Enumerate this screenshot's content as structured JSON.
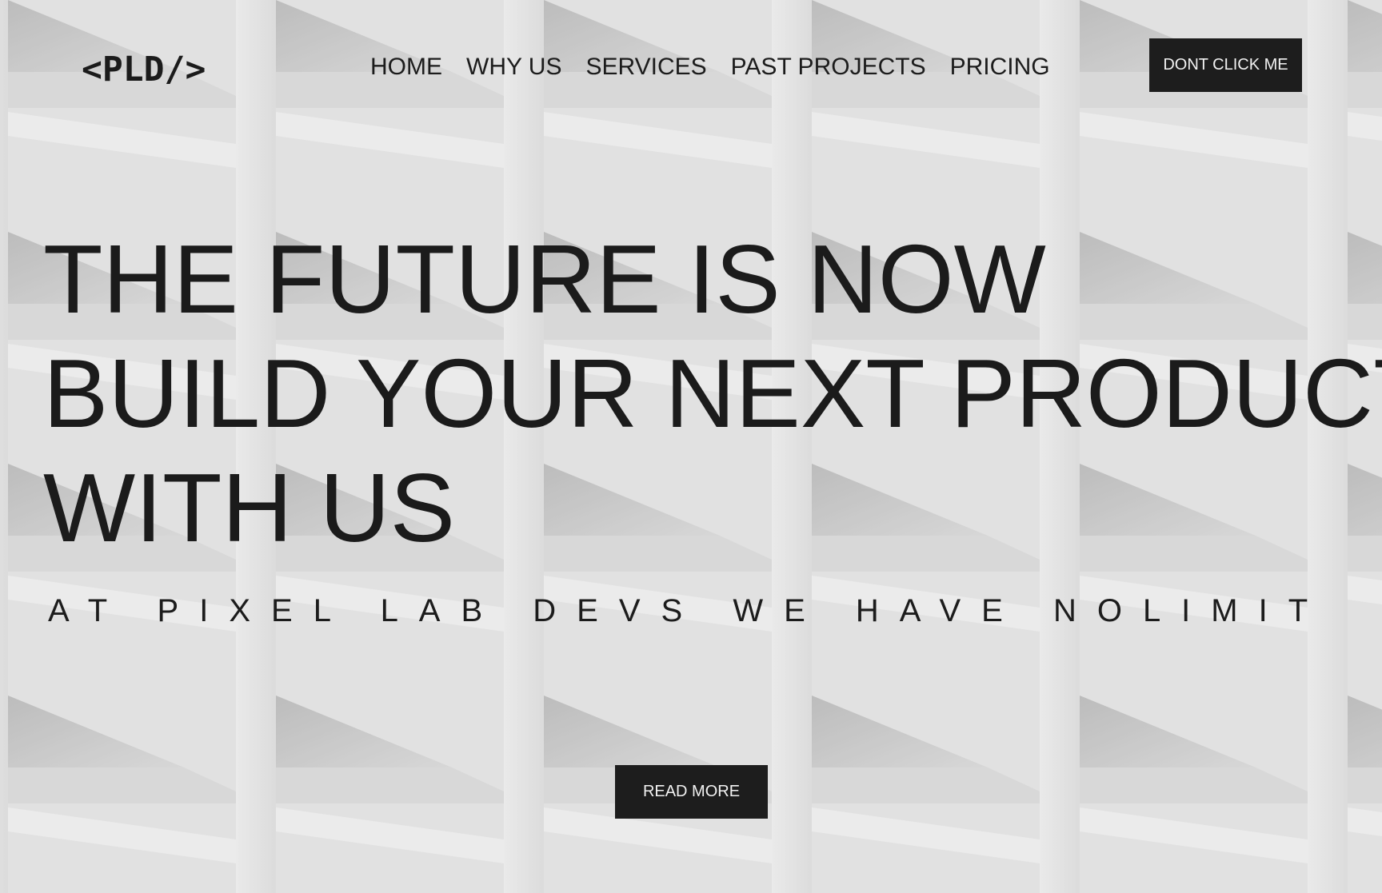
{
  "header": {
    "logo_text": "<PLD/>",
    "nav": [
      {
        "label": "HOME"
      },
      {
        "label": "WHY US"
      },
      {
        "label": "SERVICES"
      },
      {
        "label": "PAST PROJECTS"
      },
      {
        "label": "PRICING"
      }
    ],
    "cta_label": "DONT CLICK ME"
  },
  "hero": {
    "title_lines": [
      "THE FUTURE IS NOW",
      "BUILD YOUR NEXT PRODUCT",
      "WITH US"
    ],
    "subtitle": "AT PIXEL LAB DEVS WE HAVE NOLIMIT",
    "read_more_label": "READ MORE"
  },
  "colors": {
    "text": "#1c1c1c",
    "button_bg": "#1d1d1d",
    "button_text": "#f2f2f2",
    "background": "#d6d6d6"
  }
}
